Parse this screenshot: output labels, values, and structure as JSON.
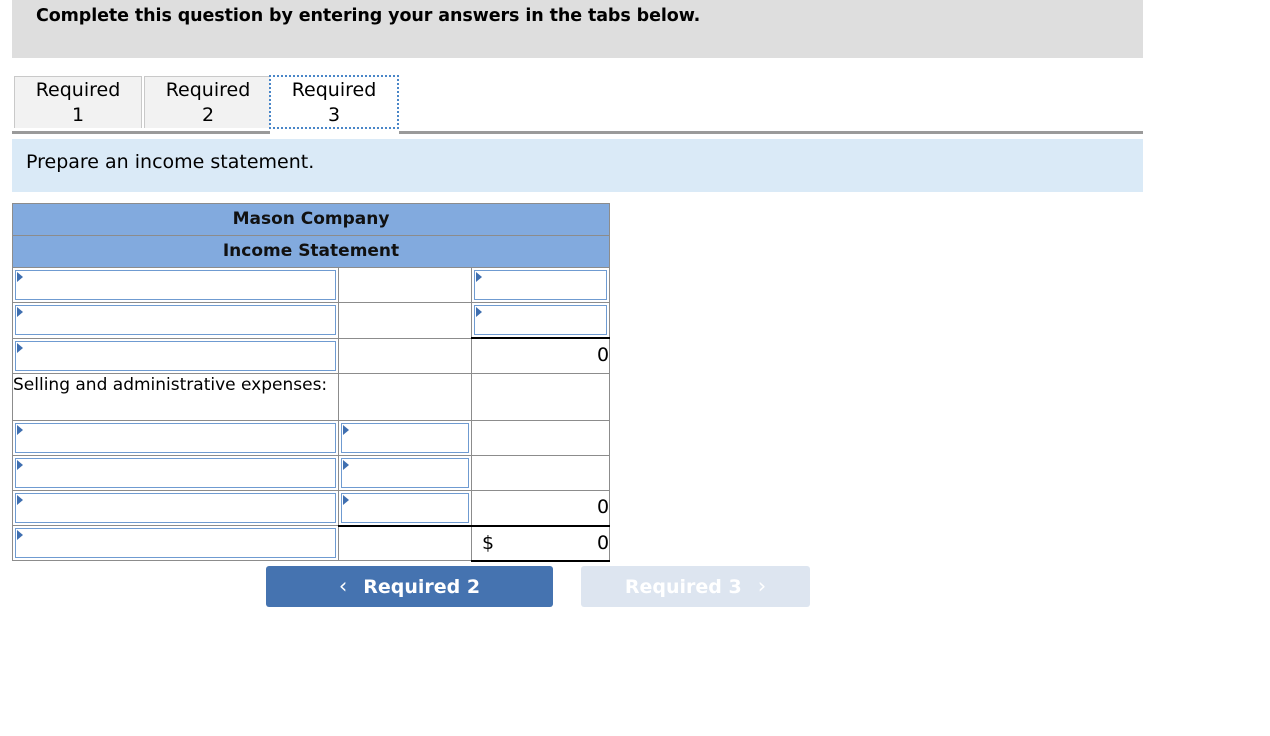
{
  "banner": {
    "text": "Complete this question by entering your answers in the tabs below."
  },
  "tabs": [
    {
      "name": "tab-required-1",
      "line1": "Required",
      "line2": "1",
      "active": false
    },
    {
      "name": "tab-required-2",
      "line1": "Required",
      "line2": "2",
      "active": false
    },
    {
      "name": "tab-required-3",
      "line1": "Required",
      "line2": "3",
      "active": true
    }
  ],
  "subbanner": {
    "text": "Prepare an income statement."
  },
  "statement": {
    "title_line1": "Mason Company",
    "title_line2": "Income Statement",
    "rows": [
      {
        "kind": "input",
        "label": "",
        "col2": "",
        "col3": "",
        "col2_input": false,
        "col3_input": true
      },
      {
        "kind": "input",
        "label": "",
        "col2": "",
        "col3": "",
        "col2_input": false,
        "col3_input": true
      },
      {
        "kind": "input",
        "label": "",
        "col2": "",
        "col3": "0",
        "col2_input": false,
        "col3_input": false
      },
      {
        "kind": "text",
        "label": "Selling and administrative expenses:",
        "col2": "",
        "col3": ""
      },
      {
        "kind": "input",
        "label": "",
        "col2": "",
        "col3": "",
        "col2_input": true,
        "col3_input": false
      },
      {
        "kind": "input",
        "label": "",
        "col2": "",
        "col3": "",
        "col2_input": true,
        "col3_input": false
      },
      {
        "kind": "input",
        "label": "",
        "col2": "",
        "col3": "0",
        "col2_input": true,
        "col3_input": false
      },
      {
        "kind": "input",
        "label": "",
        "col2": "",
        "col3": "0",
        "col3_currency": "$",
        "col2_input": false,
        "col3_input": false
      }
    ]
  },
  "nav": {
    "prev_label": "Required 2",
    "prev_chevron": "‹",
    "next_label": "Required 3",
    "next_chevron": "›"
  },
  "colors": {
    "banner_gray": "#dedede",
    "subbanner_blue": "#daeaf7",
    "header_blue": "#82aade",
    "input_border_blue": "#6f9bd1",
    "marker_blue": "#3f6fb0",
    "button_blue": "#4573b0",
    "button_disabled": "#dde5f0"
  }
}
